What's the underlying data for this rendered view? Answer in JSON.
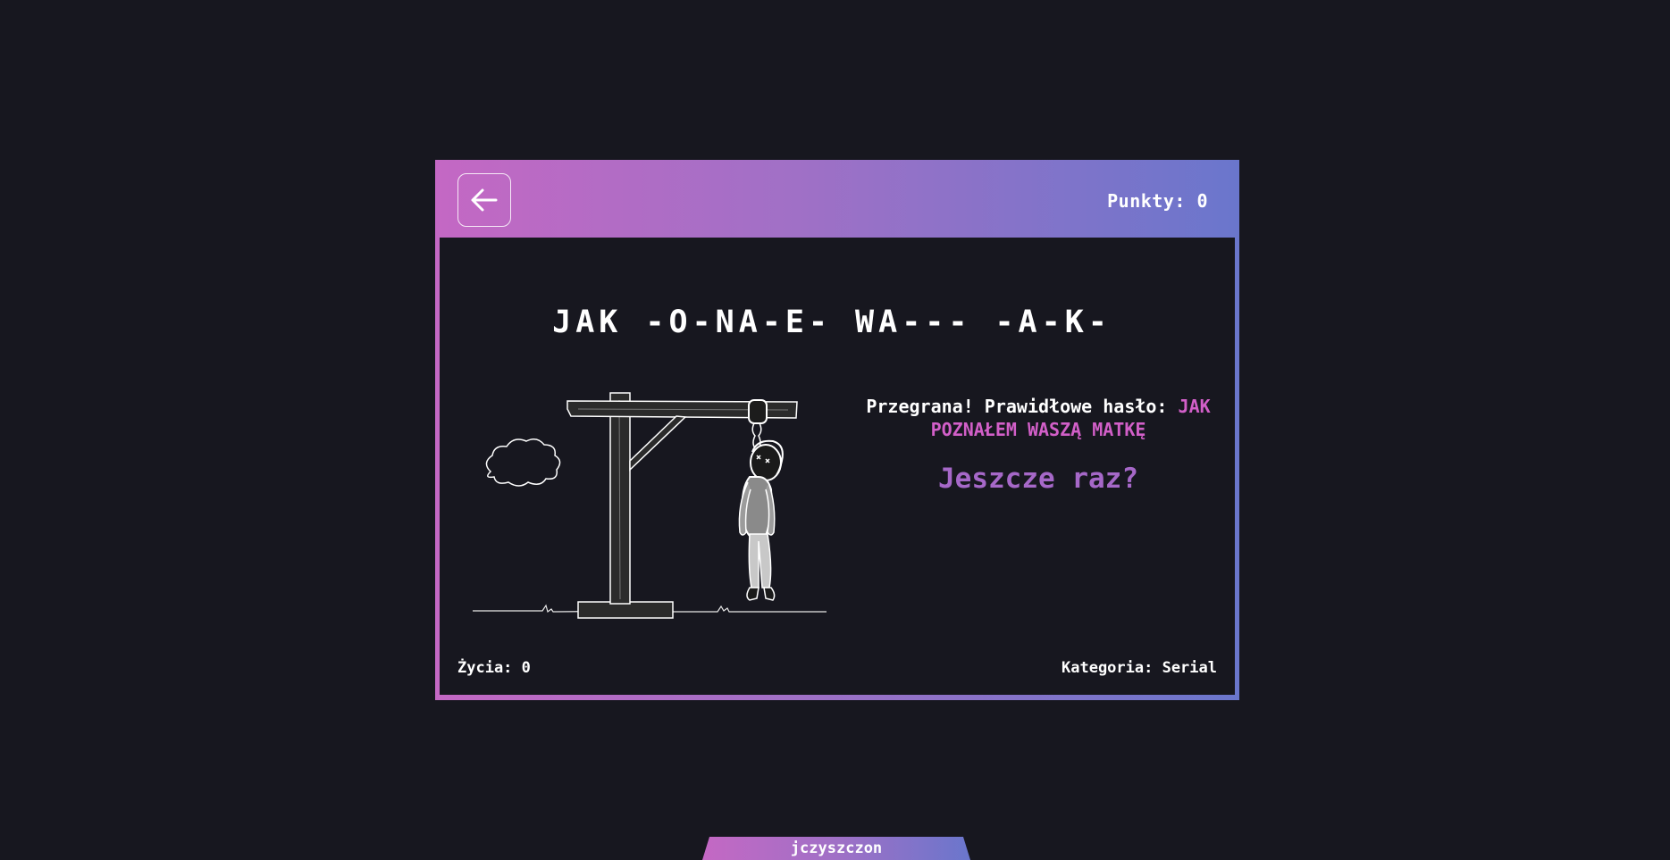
{
  "header": {
    "back_icon": "arrow-left-icon",
    "points_label": "Punkty: 0"
  },
  "game": {
    "masked_phrase": "JAK -O-NA-E- WA--- -A-K-",
    "result_prefix": "Przegrana! Prawidłowe hasło:",
    "answer": "JAK POZNAŁEM WASZĄ MATKĘ",
    "retry_label": "Jeszcze raz?",
    "lives_label": "Życia: 0",
    "category_label": "Kategoria: Serial"
  },
  "footer": {
    "author": "jczyszczon"
  },
  "colors": {
    "background": "#17171f",
    "gradient_start": "#c468c4",
    "gradient_end": "#6a76cc",
    "answer": "#d25fc8",
    "retry": "#a668c8"
  },
  "illustration": {
    "icon": "hangman-gallows-icon"
  }
}
